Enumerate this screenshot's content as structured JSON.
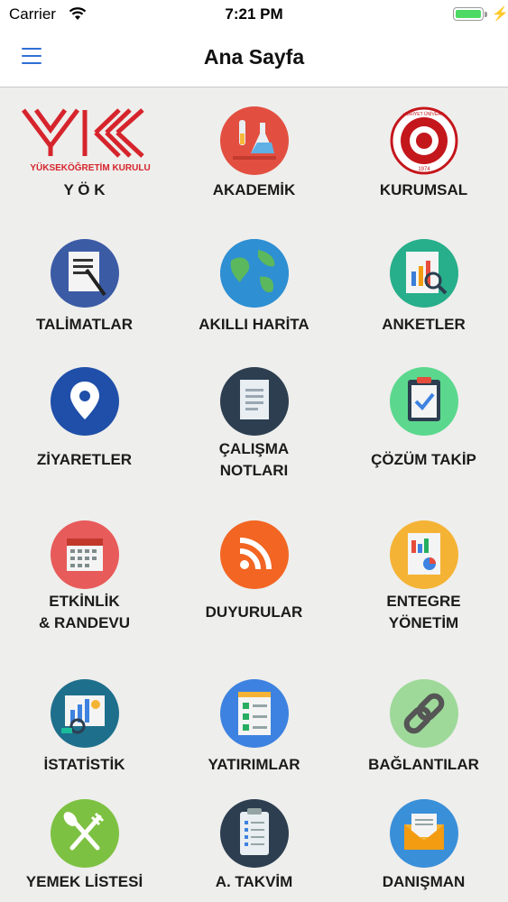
{
  "status_bar": {
    "carrier": "Carrier",
    "time": "7:21 PM",
    "battery_color": "#4cd964"
  },
  "nav": {
    "title": "Ana Sayfa",
    "menu_icon": "hamburger-menu-icon",
    "accent": "#2f6fd6"
  },
  "logos": {
    "yok_caption": "YÜKSEKÖĞRETİM KURULU",
    "seal_ring_text": "CUMHURİYET ÜNİVERSİTESİ",
    "seal_year": "1974"
  },
  "tiles": [
    {
      "label_line1": "Y Ö K",
      "label_line2": "",
      "icon": "yok-logo",
      "color": "#d6242c"
    },
    {
      "label_line1": "AKADEMİK",
      "label_line2": "",
      "icon": "chemistry-flask-icon",
      "color": "#e24f40"
    },
    {
      "label_line1": "KURUMSAL",
      "label_line2": "",
      "icon": "university-seal-logo",
      "color": "#c4171c"
    },
    {
      "label_line1": "TALİMATLAR",
      "label_line2": "",
      "icon": "document-pen-icon",
      "color": "#3b5ba5"
    },
    {
      "label_line1": "AKILLI HARİTA",
      "label_line2": "",
      "icon": "globe-icon",
      "color": "#2e8fd3"
    },
    {
      "label_line1": "ANKETLER",
      "label_line2": "",
      "icon": "survey-chart-icon",
      "color": "#27ae8a"
    },
    {
      "label_line1": "ZİYARETLER",
      "label_line2": "",
      "icon": "location-pin-icon",
      "color": "#1f4fa8"
    },
    {
      "label_line1": "ÇALIŞMA",
      "label_line2": "NOTLARI",
      "icon": "notes-document-icon",
      "color": "#2c3e50"
    },
    {
      "label_line1": "ÇÖZÜM TAKİP",
      "label_line2": "",
      "icon": "clipboard-check-icon",
      "color": "#5bd88e"
    },
    {
      "label_line1": "ETKİNLİK",
      "label_line2": "& RANDEVU",
      "icon": "calendar-icon",
      "color": "#e85b5b"
    },
    {
      "label_line1": "DUYURULAR",
      "label_line2": "",
      "icon": "rss-feed-icon",
      "color": "#f26522"
    },
    {
      "label_line1": "ENTEGRE",
      "label_line2": "YÖNETİM",
      "icon": "report-chart-icon",
      "color": "#f5b335"
    },
    {
      "label_line1": "İSTATİSTİK",
      "label_line2": "",
      "icon": "statistics-icon",
      "color": "#1e6f8c"
    },
    {
      "label_line1": "YATIRIMLAR",
      "label_line2": "",
      "icon": "checklist-icon",
      "color": "#3d82e0"
    },
    {
      "label_line1": "BAĞLANTILAR",
      "label_line2": "",
      "icon": "chain-link-icon",
      "color": "#9ed99a"
    },
    {
      "label_line1": "YEMEK LİSTESİ",
      "label_line2": "",
      "icon": "fork-spoon-icon",
      "color": "#7dc142"
    },
    {
      "label_line1": "A. TAKVİM",
      "label_line2": "",
      "icon": "calendar-list-icon",
      "color": "#2c3e50"
    },
    {
      "label_line1": "DANIŞMAN",
      "label_line2": "",
      "icon": "envelope-icon",
      "color": "#3a8fd9"
    }
  ]
}
